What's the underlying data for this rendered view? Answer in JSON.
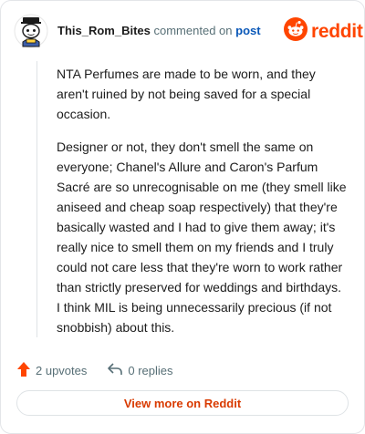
{
  "header": {
    "username": "This_Rom_Bites",
    "action": "commented on",
    "post_link": "post",
    "logo_text": "reddit"
  },
  "comment": {
    "paragraphs": [
      "NTA Perfumes are made to be worn, and they aren't ruined by not being saved for a special occasion.",
      "Designer or not, they don't smell the same on everyone; Chanel's Allure and Caron's Parfum Sacré are so unrecognisable on me (they smell like aniseed and cheap soap respectively) that they're basically wasted and I had to give them away; it's really nice to smell them on my friends and I truly could not care less that they're worn to work rather than strictly preserved for weddings and birthdays. I think MIL is being unnecessarily precious (if not snobbish) about this."
    ]
  },
  "footer": {
    "upvotes": "2 upvotes",
    "replies": "0 replies",
    "view_more": "View more on Reddit"
  },
  "colors": {
    "brand": "#ff4500",
    "link": "#0a58b8",
    "muted": "#576f76",
    "view_more": "#d93a00"
  },
  "icons": {
    "avatar": "snoo-avatar-icon",
    "logo": "reddit-snoo-icon",
    "upvote": "upvote-arrow-icon",
    "reply": "reply-arrow-icon"
  }
}
